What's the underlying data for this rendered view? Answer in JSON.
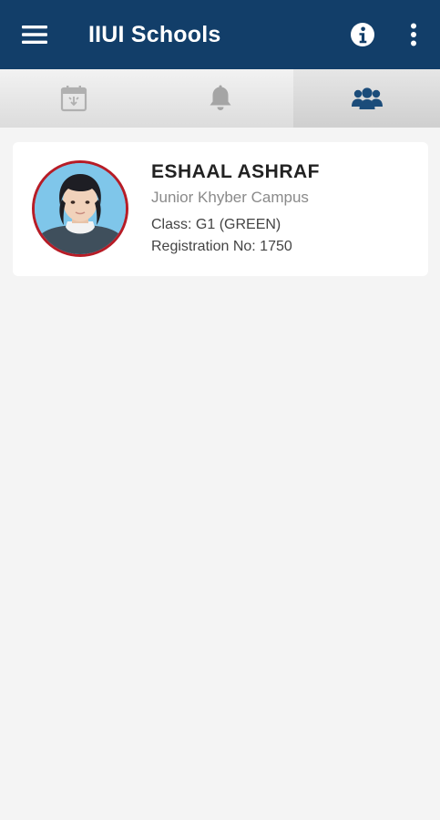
{
  "app": {
    "title": "IIUI Schools"
  },
  "icons": {
    "menu": "menu-icon",
    "info": "info-icon",
    "more": "more-vert-icon",
    "tab_calendar": "calendar-icon",
    "tab_notifications": "bell-icon",
    "tab_students": "group-icon"
  },
  "colors": {
    "appbar": "#123e69",
    "accent_ring": "#b71c26",
    "active_tab_icon": "#123e69",
    "inactive_tab_icon": "#9e9e9e"
  },
  "tabs": [
    {
      "name": "calendar",
      "active": false
    },
    {
      "name": "notifications",
      "active": false
    },
    {
      "name": "students",
      "active": true
    }
  ],
  "student": {
    "name": "ESHAAL ASHRAF",
    "campus": "Junior Khyber Campus",
    "class": "Class: G1 (GREEN)",
    "registration": "Registration No: 1750"
  }
}
